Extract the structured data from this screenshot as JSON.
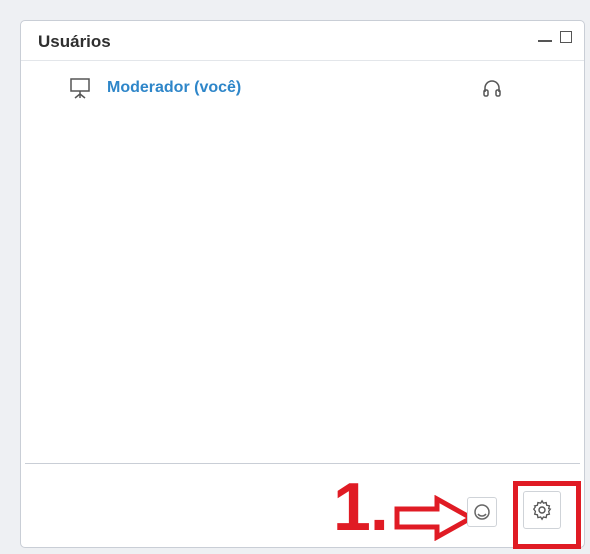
{
  "panel": {
    "title": "Usuários"
  },
  "window_controls": {
    "minimize_icon": "minimize-icon",
    "maximize_icon": "maximize-icon"
  },
  "users": [
    {
      "name": "Moderador (você)",
      "role_icon": "presenter-icon",
      "audio_icon": "headset-icon"
    }
  ],
  "footer": {
    "annotation_label": "1.",
    "status_icon": "status-icon",
    "settings_icon": "gear-icon"
  },
  "colors": {
    "accent_blue": "#2e86c9",
    "annotation_red": "#e01b24",
    "border": "#c9ced6"
  }
}
